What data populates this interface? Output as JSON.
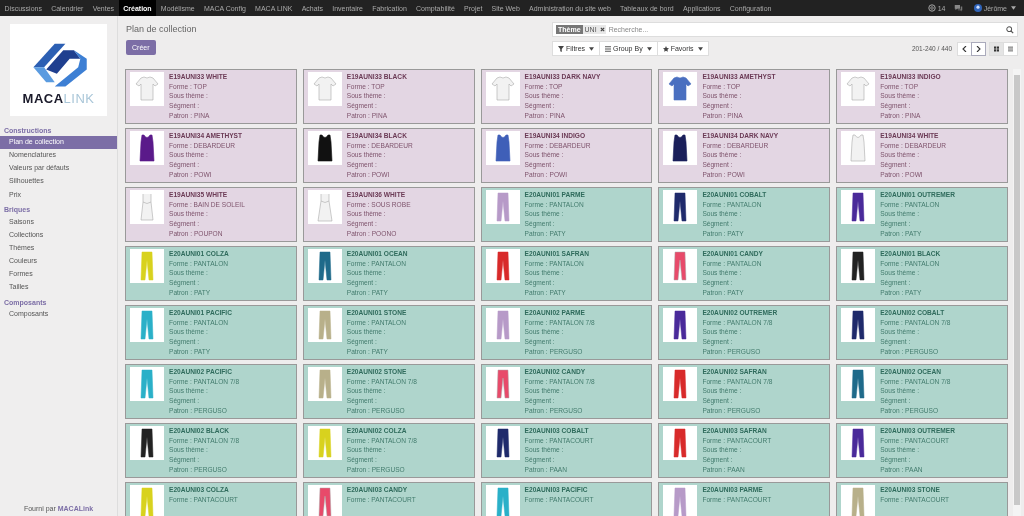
{
  "top_nav": {
    "items": [
      {
        "label": "Discussions",
        "selected": false
      },
      {
        "label": "Calendrier",
        "selected": false
      },
      {
        "label": "Ventes",
        "selected": false
      },
      {
        "label": "Création",
        "selected": true
      },
      {
        "label": "Modélisme",
        "selected": false
      },
      {
        "label": "MACA Config",
        "selected": false
      },
      {
        "label": "MACA LINK",
        "selected": false
      },
      {
        "label": "Achats",
        "selected": false
      },
      {
        "label": "Inventaire",
        "selected": false
      },
      {
        "label": "Fabrication",
        "selected": false
      },
      {
        "label": "Comptabilité",
        "selected": false
      },
      {
        "label": "Projet",
        "selected": false
      },
      {
        "label": "Site Web",
        "selected": false
      },
      {
        "label": "Administration du site web",
        "selected": false
      },
      {
        "label": "Tableaux de bord",
        "selected": false
      },
      {
        "label": "Applications",
        "selected": false
      },
      {
        "label": "Configuration",
        "selected": false
      }
    ],
    "notification_count": "14",
    "user": "Jérôme"
  },
  "sidebar": {
    "logo_text": "**MACA**LINK",
    "sections": [
      {
        "title": "Constructions",
        "items": [
          {
            "label": "Plan de collection",
            "selected": true
          },
          {
            "label": "Nomenclatures",
            "selected": false
          },
          {
            "label": "Valeurs par défauts",
            "selected": false
          },
          {
            "label": "Silhouettes",
            "selected": false
          },
          {
            "label": "Prix",
            "selected": false
          }
        ]
      },
      {
        "title": "Briques",
        "items": [
          {
            "label": "Saisons",
            "selected": false
          },
          {
            "label": "Collections",
            "selected": false
          },
          {
            "label": "Thèmes",
            "selected": false
          },
          {
            "label": "Couleurs",
            "selected": false
          },
          {
            "label": "Formes",
            "selected": false
          },
          {
            "label": "Tailles",
            "selected": false
          }
        ]
      },
      {
        "title": "Composants",
        "items": [
          {
            "label": "Composants",
            "selected": false
          }
        ]
      }
    ],
    "footer": "Fourni par **MACALink**"
  },
  "breadcrumb": "Plan de collection",
  "create_button": "Créer",
  "search": {
    "facet_label": "Thème",
    "facet_value": "UNI",
    "placeholder": "Recherche..."
  },
  "filters": [
    "Filtres",
    "Group By",
    "Favoris"
  ],
  "pager": "201-240 / 440",
  "views": [
    {
      "kind": "kanban",
      "selected": true
    },
    {
      "kind": "list",
      "selected": false
    }
  ],
  "cards": [
    {
      "title": "E19AUNI33 WHITE",
      "color": "#e3d6e3",
      "garment": {
        "kind": "top",
        "color": "#f2f2f2"
      },
      "lines": [
        "Forme : TOP",
        "Sous thème :",
        "Ségment :",
        "Patron : PINA"
      ]
    },
    {
      "title": "E19AUNI33 BLACK",
      "color": "#e3d6e3",
      "garment": {
        "kind": "top",
        "color": "#f2f2f2"
      },
      "lines": [
        "Forme : TOP",
        "Sous thème :",
        "Ségment :",
        "Patron : PINA"
      ]
    },
    {
      "title": "E19AUNI33 DARK NAVY",
      "color": "#e3d6e3",
      "garment": {
        "kind": "top",
        "color": "#f2f2f2"
      },
      "lines": [
        "Forme : TOP",
        "Sous thème :",
        "Ségment :",
        "Patron : PINA"
      ]
    },
    {
      "title": "E19AUNI33 AMETHYST",
      "color": "#e3d6e3",
      "garment": {
        "kind": "top",
        "color": "#4a6fc0"
      },
      "lines": [
        "Forme : TOP",
        "Sous thème :",
        "Ségment :",
        "Patron : PINA"
      ]
    },
    {
      "title": "E19AUNI33 INDIGO",
      "color": "#e3d6e3",
      "garment": {
        "kind": "top",
        "color": "#f2f2f2"
      },
      "lines": [
        "Forme : TOP",
        "Sous thème :",
        "Ségment :",
        "Patron : PINA"
      ]
    },
    {
      "title": "E19AUNI34 AMETHYST",
      "color": "#e3d6e3",
      "garment": {
        "kind": "tank",
        "color": "#5a1a8a"
      },
      "lines": [
        "Forme : DEBARDEUR",
        "Sous thème :",
        "Ségment :",
        "Patron : POWI"
      ]
    },
    {
      "title": "E19AUNI34 BLACK",
      "color": "#e3d6e3",
      "garment": {
        "kind": "tank",
        "color": "#111111"
      },
      "lines": [
        "Forme : DEBARDEUR",
        "Sous thème :",
        "Ségment :",
        "Patron : POWI"
      ]
    },
    {
      "title": "E19AUNI34 INDIGO",
      "color": "#e3d6e3",
      "garment": {
        "kind": "tank",
        "color": "#3f5fb8"
      },
      "lines": [
        "Forme : DEBARDEUR",
        "Sous thème :",
        "Ségment :",
        "Patron : POWI"
      ]
    },
    {
      "title": "E19AUNI34 DARK NAVY",
      "color": "#e3d6e3",
      "garment": {
        "kind": "tank",
        "color": "#1a1f5a"
      },
      "lines": [
        "Forme : DEBARDEUR",
        "Sous thème :",
        "Ségment :",
        "Patron : POWI"
      ]
    },
    {
      "title": "E19AUNI34 WHITE",
      "color": "#e3d6e3",
      "garment": {
        "kind": "tank",
        "color": "#f2f2f2"
      },
      "lines": [
        "Forme : DEBARDEUR",
        "Sous thème :",
        "Ségment :",
        "Patron : POWI"
      ]
    },
    {
      "title": "E19AUNI35 WHITE",
      "color": "#e3d6e3",
      "garment": {
        "kind": "cami",
        "color": "#f2f2f2"
      },
      "lines": [
        "Forme : BAIN DE SOLEIL",
        "Sous thème :",
        "Ségment :",
        "Patron : POUPON"
      ]
    },
    {
      "title": "E19AUNI36 WHITE",
      "color": "#e3d6e3",
      "garment": {
        "kind": "slip",
        "color": "#f2f2f2"
      },
      "lines": [
        "Forme : SOUS ROBE",
        "Sous thème :",
        "Ségment :",
        "Patron : POONO"
      ]
    },
    {
      "title": "E20AUNI01 PARME",
      "color": "#afd5cc",
      "garment": {
        "kind": "pants",
        "color": "#b79ac8"
      },
      "lines": [
        "Forme : PANTALON",
        "Sous thème :",
        "Ségment :",
        "Patron : PATY"
      ]
    },
    {
      "title": "E20AUNI01 COBALT",
      "color": "#afd5cc",
      "garment": {
        "kind": "pants",
        "color": "#1f2a6b"
      },
      "lines": [
        "Forme : PANTALON",
        "Sous thème :",
        "Ségment :",
        "Patron : PATY"
      ]
    },
    {
      "title": "E20AUNI01 OUTREMER",
      "color": "#afd5cc",
      "garment": {
        "kind": "pants",
        "color": "#4a2a9a"
      },
      "lines": [
        "Forme : PANTALON",
        "Sous thème :",
        "Ségment :",
        "Patron : PATY"
      ]
    },
    {
      "title": "E20AUNI01 COLZA",
      "color": "#afd5cc",
      "garment": {
        "kind": "pants",
        "color": "#d8d21e"
      },
      "lines": [
        "Forme : PANTALON",
        "Sous thème :",
        "Ségment :",
        "Patron : PATY"
      ]
    },
    {
      "title": "E20AUNI01 OCEAN",
      "color": "#afd5cc",
      "garment": {
        "kind": "pants",
        "color": "#1f6a8a"
      },
      "lines": [
        "Forme : PANTALON",
        "Sous thème :",
        "Ségment :",
        "Patron : PATY"
      ]
    },
    {
      "title": "E20AUNI01 SAFRAN",
      "color": "#afd5cc",
      "garment": {
        "kind": "pants",
        "color": "#d82a2a"
      },
      "lines": [
        "Forme : PANTALON",
        "Sous thème :",
        "Ségment :",
        "Patron : PATY"
      ]
    },
    {
      "title": "E20AUNI01 CANDY",
      "color": "#afd5cc",
      "garment": {
        "kind": "pants",
        "color": "#e84a6a"
      },
      "lines": [
        "Forme : PANTALON",
        "Sous thème :",
        "Ségment :",
        "Patron : PATY"
      ]
    },
    {
      "title": "E20AUNI01 BLACK",
      "color": "#afd5cc",
      "garment": {
        "kind": "pants",
        "color": "#222222"
      },
      "lines": [
        "Forme : PANTALON",
        "Sous thème :",
        "Ségment :",
        "Patron : PATY"
      ]
    },
    {
      "title": "E20AUNI01 PACIFIC",
      "color": "#afd5cc",
      "garment": {
        "kind": "pants",
        "color": "#2ab0c8"
      },
      "lines": [
        "Forme : PANTALON",
        "Sous thème :",
        "Ségment :",
        "Patron : PATY"
      ]
    },
    {
      "title": "E20AUNI01 STONE",
      "color": "#afd5cc",
      "garment": {
        "kind": "pants",
        "color": "#b8b08a"
      },
      "lines": [
        "Forme : PANTALON",
        "Sous thème :",
        "Ségment :",
        "Patron : PATY"
      ]
    },
    {
      "title": "E20AUNI02 PARME",
      "color": "#afd5cc",
      "garment": {
        "kind": "pants",
        "color": "#b79ac8"
      },
      "lines": [
        "Forme : PANTALON 7/8",
        "Sous thème :",
        "Ségment :",
        "Patron : PERGUSO"
      ]
    },
    {
      "title": "E20AUNI02 OUTREMER",
      "color": "#afd5cc",
      "garment": {
        "kind": "pants",
        "color": "#4a2a9a"
      },
      "lines": [
        "Forme : PANTALON 7/8",
        "Sous thème :",
        "Ségment :",
        "Patron : PERGUSO"
      ]
    },
    {
      "title": "E20AUNI02 COBALT",
      "color": "#afd5cc",
      "garment": {
        "kind": "pants",
        "color": "#1f2a6b"
      },
      "lines": [
        "Forme : PANTALON 7/8",
        "Sous thème :",
        "Ségment :",
        "Patron : PERGUSO"
      ]
    },
    {
      "title": "E20AUNI02 PACIFIC",
      "color": "#afd5cc",
      "garment": {
        "kind": "pants",
        "color": "#2ab0c8"
      },
      "lines": [
        "Forme : PANTALON 7/8",
        "Sous thème :",
        "Ségment :",
        "Patron : PERGUSO"
      ]
    },
    {
      "title": "E20AUNI02 STONE",
      "color": "#afd5cc",
      "garment": {
        "kind": "pants",
        "color": "#b8b08a"
      },
      "lines": [
        "Forme : PANTALON 7/8",
        "Sous thème :",
        "Ségment :",
        "Patron : PERGUSO"
      ]
    },
    {
      "title": "E20AUNI02 CANDY",
      "color": "#afd5cc",
      "garment": {
        "kind": "pants",
        "color": "#e84a6a"
      },
      "lines": [
        "Forme : PANTALON 7/8",
        "Sous thème :",
        "Ségment :",
        "Patron : PERGUSO"
      ]
    },
    {
      "title": "E20AUNI02 SAFRAN",
      "color": "#afd5cc",
      "garment": {
        "kind": "pants",
        "color": "#d82a2a"
      },
      "lines": [
        "Forme : PANTALON 7/8",
        "Sous thème :",
        "Ségment :",
        "Patron : PERGUSO"
      ]
    },
    {
      "title": "E20AUNI02 OCEAN",
      "color": "#afd5cc",
      "garment": {
        "kind": "pants",
        "color": "#1f6a8a"
      },
      "lines": [
        "Forme : PANTALON 7/8",
        "Sous thème :",
        "Ségment :",
        "Patron : PERGUSO"
      ]
    },
    {
      "title": "E20AUNI02 BLACK",
      "color": "#afd5cc",
      "garment": {
        "kind": "pants",
        "color": "#222222"
      },
      "lines": [
        "Forme : PANTALON 7/8",
        "Sous thème :",
        "Ségment :",
        "Patron : PERGUSO"
      ]
    },
    {
      "title": "E20AUNI02 COLZA",
      "color": "#afd5cc",
      "garment": {
        "kind": "pants",
        "color": "#d8d21e"
      },
      "lines": [
        "Forme : PANTALON 7/8",
        "Sous thème :",
        "Ségment :",
        "Patron : PERGUSO"
      ]
    },
    {
      "title": "E20AUNI03 COBALT",
      "color": "#afd5cc",
      "garment": {
        "kind": "pants",
        "color": "#1f2a6b"
      },
      "lines": [
        "Forme : PANTACOURT",
        "Sous thème :",
        "Ségment :",
        "Patron : PAAN"
      ]
    },
    {
      "title": "E20AUNI03 SAFRAN",
      "color": "#afd5cc",
      "garment": {
        "kind": "pants",
        "color": "#d82a2a"
      },
      "lines": [
        "Forme : PANTACOURT",
        "Sous thème :",
        "Ségment :",
        "Patron : PAAN"
      ]
    },
    {
      "title": "E20AUNI03 OUTREMER",
      "color": "#afd5cc",
      "garment": {
        "kind": "pants",
        "color": "#4a2a9a"
      },
      "lines": [
        "Forme : PANTACOURT",
        "Sous thème :",
        "Ségment :",
        "Patron : PAAN"
      ]
    },
    {
      "title": "E20AUNI03 COLZA",
      "color": "#afd5cc",
      "garment": {
        "kind": "pants",
        "color": "#d8d21e"
      },
      "lines": [
        "Forme : PANTACOURT"
      ]
    },
    {
      "title": "E20AUNI03 CANDY",
      "color": "#afd5cc",
      "garment": {
        "kind": "pants",
        "color": "#e84a6a"
      },
      "lines": [
        "Forme : PANTACOURT"
      ]
    },
    {
      "title": "E20AUNI03 PACIFIC",
      "color": "#afd5cc",
      "garment": {
        "kind": "pants",
        "color": "#2ab0c8"
      },
      "lines": [
        "Forme : PANTACOURT"
      ]
    },
    {
      "title": "E20AUNI03 PARME",
      "color": "#afd5cc",
      "garment": {
        "kind": "pants",
        "color": "#b79ac8"
      },
      "lines": [
        "Forme : PANTACOURT"
      ]
    },
    {
      "title": "E20AUNI03 STONE",
      "color": "#afd5cc",
      "garment": {
        "kind": "pants",
        "color": "#b8b08a"
      },
      "lines": [
        "Forme : PANTACOURT"
      ]
    }
  ]
}
